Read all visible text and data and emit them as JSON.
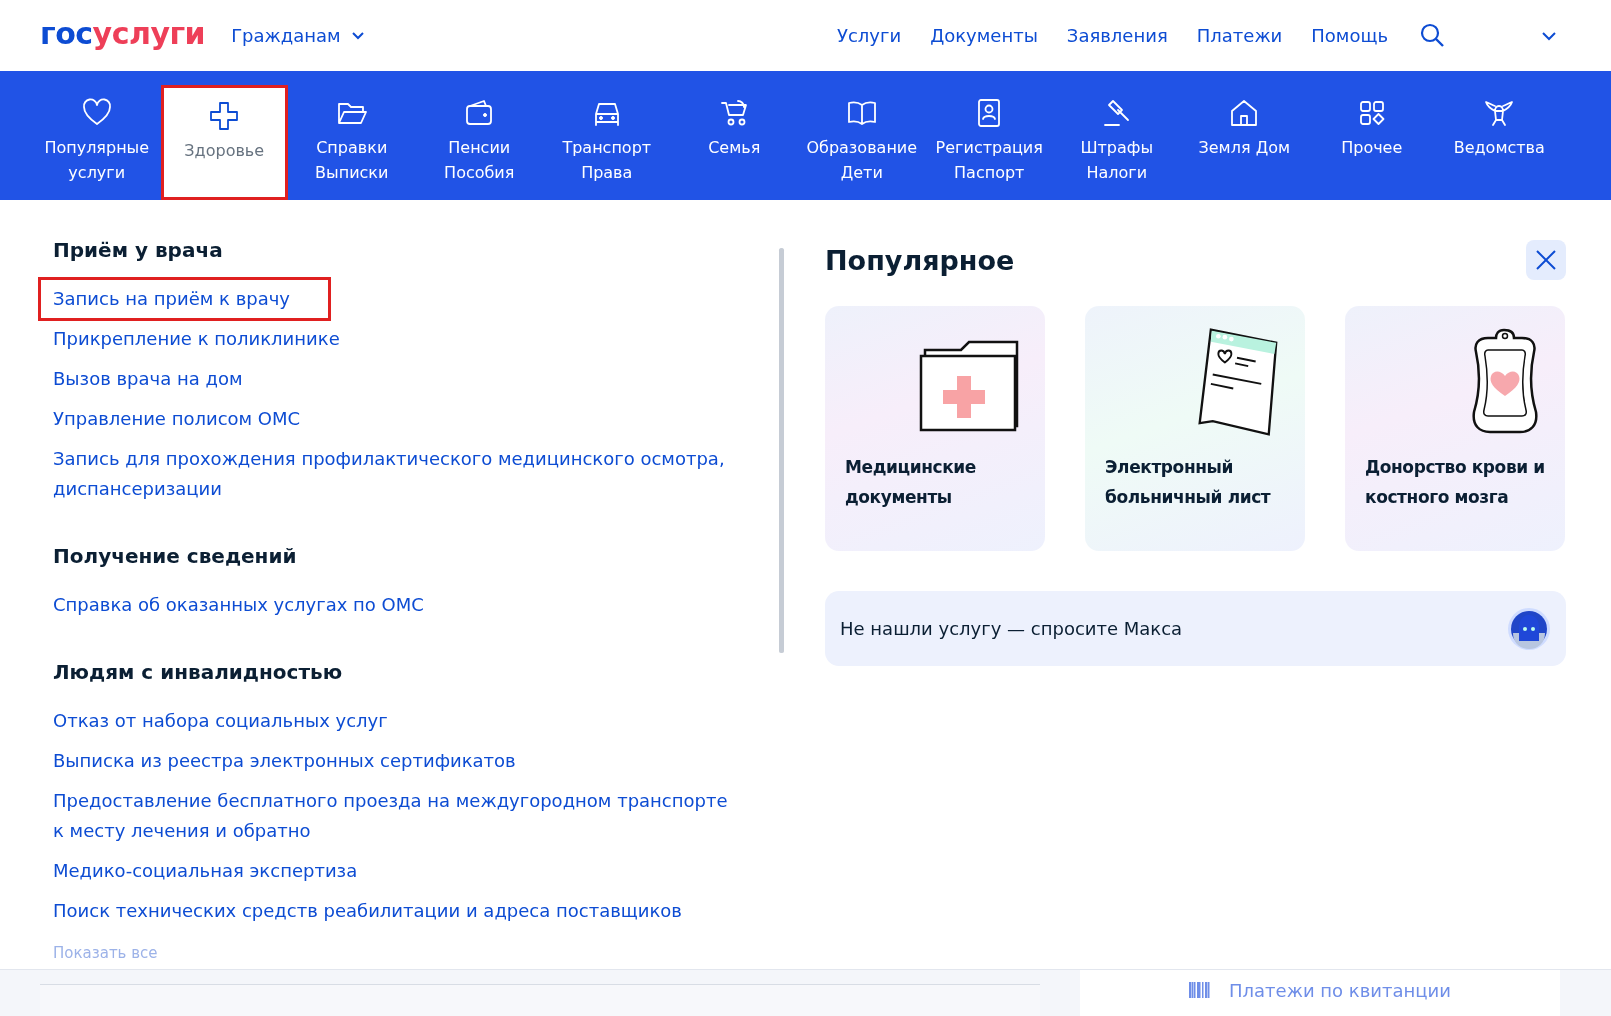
{
  "header": {
    "logo": {
      "first": "гос",
      "second": "услуги"
    },
    "audience": "Гражданам",
    "nav": [
      "Услуги",
      "Документы",
      "Заявления",
      "Платежи",
      "Помощь"
    ]
  },
  "categories": [
    {
      "lines": [
        "Популярные",
        "услуги"
      ],
      "selected": false,
      "highlighted": false
    },
    {
      "lines": [
        "Здоровье"
      ],
      "selected": true,
      "highlighted": true
    },
    {
      "lines": [
        "Справки",
        "Выписки"
      ],
      "selected": false,
      "highlighted": false
    },
    {
      "lines": [
        "Пенсии",
        "Пособия"
      ],
      "selected": false,
      "highlighted": false
    },
    {
      "lines": [
        "Транспорт",
        "Права"
      ],
      "selected": false,
      "highlighted": false
    },
    {
      "lines": [
        "Семья"
      ],
      "selected": false,
      "highlighted": false
    },
    {
      "lines": [
        "Образование",
        "Дети"
      ],
      "selected": false,
      "highlighted": false
    },
    {
      "lines": [
        "Регистрация",
        "Паспорт"
      ],
      "selected": false,
      "highlighted": false
    },
    {
      "lines": [
        "Штрафы",
        "Налоги"
      ],
      "selected": false,
      "highlighted": false
    },
    {
      "lines": [
        "Земля Дом"
      ],
      "selected": false,
      "highlighted": false
    },
    {
      "lines": [
        "Прочее"
      ],
      "selected": false,
      "highlighted": false
    },
    {
      "lines": [
        "Ведомства"
      ],
      "selected": false,
      "highlighted": false
    }
  ],
  "sections": [
    {
      "title": "Приём у врача",
      "links": [
        {
          "text": "Запись на приём к врачу",
          "highlighted": true
        },
        {
          "text": "Прикрепление к поликлинике",
          "highlighted": false
        },
        {
          "text": "Вызов врача на дом",
          "highlighted": false
        },
        {
          "text": "Управление полисом ОМС",
          "highlighted": false
        },
        {
          "text": "Запись для прохождения профилактического медицинского осмотра, диспансеризации",
          "highlighted": false
        }
      ]
    },
    {
      "title": "Получение сведений",
      "links": [
        {
          "text": "Справка об оказанных услугах по ОМС",
          "highlighted": false
        }
      ]
    },
    {
      "title": "Людям с инвалидностью",
      "links": [
        {
          "text": "Отказ от набора социальных услуг",
          "highlighted": false
        },
        {
          "text": "Выписка из реестра электронных сертификатов",
          "highlighted": false
        },
        {
          "text": "Предоставление бесплатного проезда на междугородном транспорте к месту лечения и обратно",
          "highlighted": false
        },
        {
          "text": "Медико-социальная экспертиза",
          "highlighted": false
        },
        {
          "text": "Поиск технических средств реабилитации и адреса поставщиков",
          "highlighted": false
        }
      ]
    }
  ],
  "show_all": "Показать все",
  "popular": {
    "title": "Популярное",
    "cards": [
      {
        "kind": "folder",
        "title": "Медицинские документы"
      },
      {
        "kind": "sheet",
        "title": "Электронный больничный лист"
      },
      {
        "kind": "bag",
        "title": "Донорство крови и костного мозга"
      }
    ],
    "assistant": "Не нашли услугу — спросите Макса"
  },
  "background": {
    "link": "Платежи по квитанции"
  }
}
